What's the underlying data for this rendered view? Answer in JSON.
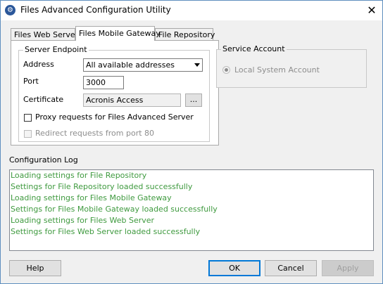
{
  "window": {
    "title": "Files Advanced Configuration Utility",
    "app_icon": "gear-icon",
    "close_glyph": "✕"
  },
  "tabs": [
    {
      "label": "Files Web Server",
      "active": false
    },
    {
      "label": "Files Mobile Gateway",
      "active": true
    },
    {
      "label": "File Repository",
      "active": false
    }
  ],
  "server_endpoint": {
    "title": "Server Endpoint",
    "address_label": "Address",
    "address_value": "All available addresses",
    "port_label": "Port",
    "port_value": "3000",
    "certificate_label": "Certificate",
    "certificate_value": "Acronis Access",
    "browse_label": "...",
    "proxy_label": "Proxy requests for Files Advanced Server",
    "proxy_checked": false,
    "redirect_label": "Redirect requests from port 80",
    "redirect_checked": false,
    "redirect_enabled": false
  },
  "service_account": {
    "title": "Service Account",
    "local_system_label": "Local System Account",
    "local_system_selected": true,
    "enabled": false
  },
  "config_log": {
    "label": "Configuration Log",
    "lines": [
      "Loading settings for File Repository",
      "Settings for File Repository loaded successfully",
      "Loading settings for Files Mobile Gateway",
      "Settings for Files Mobile Gateway loaded successfully",
      "Loading settings for Files Web Server",
      "Settings for Files Web Server loaded successfully"
    ],
    "text_color": "#3f9a3f"
  },
  "buttons": {
    "help": "Help",
    "ok": "OK",
    "cancel": "Cancel",
    "apply": "Apply"
  }
}
